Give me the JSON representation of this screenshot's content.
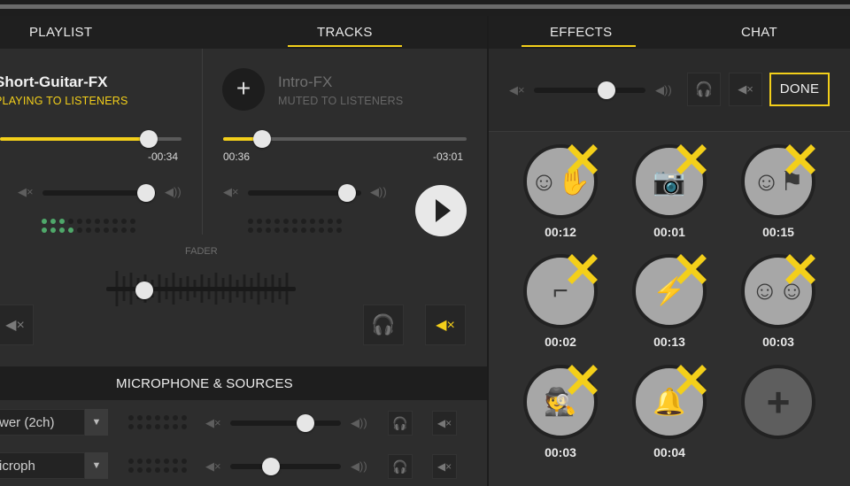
{
  "tabs_left": [
    "PLAYLIST",
    "TRACKS"
  ],
  "tabs_right": [
    "EFFECTS",
    "CHAT"
  ],
  "deck_a": {
    "title": "Short-Guitar-FX",
    "status": "PLAYING TO LISTENERS",
    "remaining": "-00:34",
    "progress": 0.82,
    "volume": 0.75
  },
  "deck_b": {
    "title": "Intro-FX",
    "status": "MUTED TO LISTENERS",
    "elapsed": "00:36",
    "remaining": "-03:01",
    "progress": 0.16,
    "volume": 0.72
  },
  "fader_label": "FADER",
  "fader_value": 0.2,
  "section_title": "MICROPHONE & SOURCES",
  "sources": [
    {
      "name": "wer (2ch)",
      "volume": 0.68,
      "headphone_active": true
    },
    {
      "name": "icroph",
      "volume": 0.37,
      "headphone_active": false
    }
  ],
  "effects_master_volume": 0.65,
  "done_label": "DONE",
  "effects": [
    {
      "icon": "emoji-hand-icon",
      "duration": "00:12"
    },
    {
      "icon": "camera-icon",
      "duration": "00:01"
    },
    {
      "icon": "emoji-flag-icon",
      "duration": "00:15"
    },
    {
      "icon": "gun-icon",
      "duration": "00:02"
    },
    {
      "icon": "lightning-icon",
      "duration": "00:13"
    },
    {
      "icon": "emoji-group-icon",
      "duration": "00:03"
    },
    {
      "icon": "spy-icon",
      "duration": "00:03"
    },
    {
      "icon": "bell-icon",
      "duration": "00:04"
    }
  ],
  "colors": {
    "accent": "#f3cf1a",
    "meter": "#4fa86a",
    "panel": "#2d2d2d"
  }
}
